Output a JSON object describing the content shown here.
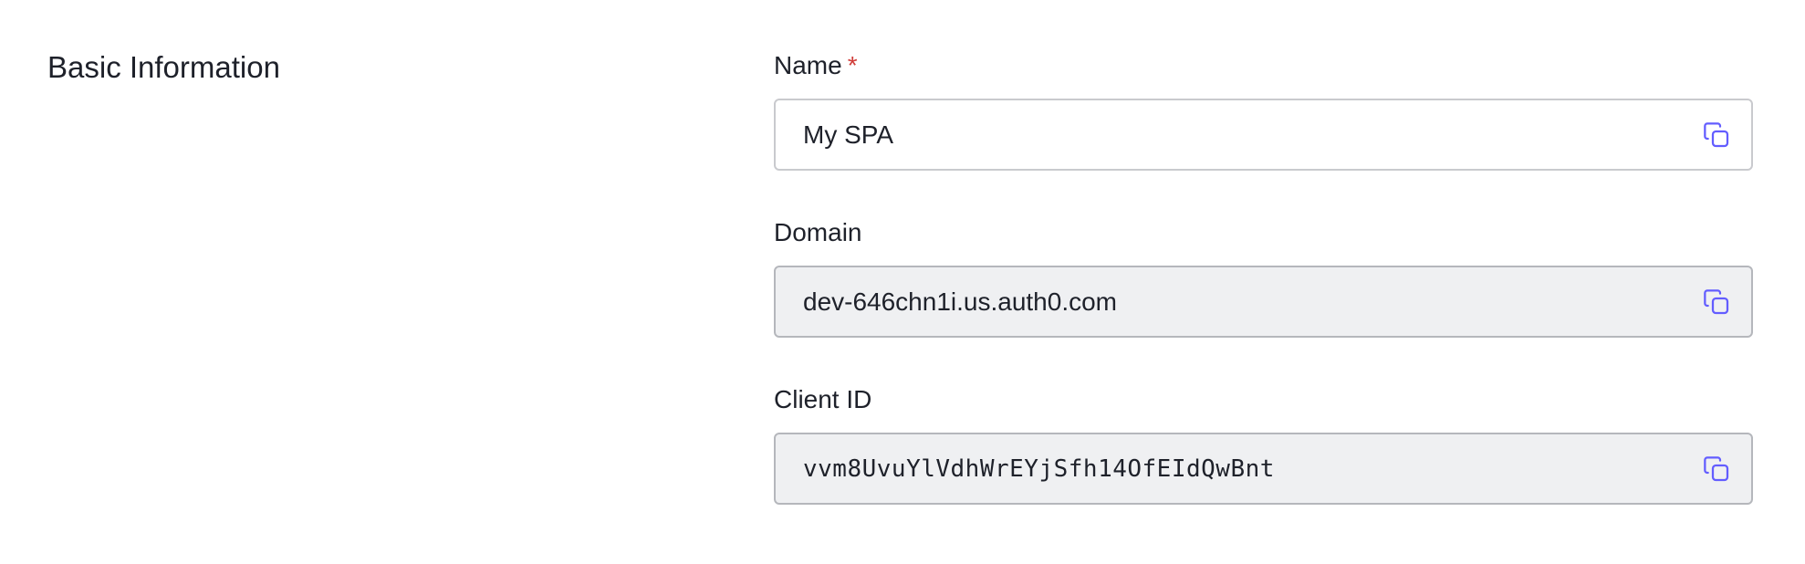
{
  "section": {
    "title": "Basic Information"
  },
  "fields": {
    "name": {
      "label": "Name",
      "required_mark": "*",
      "value": "My SPA",
      "copy_icon": "copy-icon"
    },
    "domain": {
      "label": "Domain",
      "value": "dev-646chn1i.us.auth0.com",
      "copy_icon": "copy-icon"
    },
    "client_id": {
      "label": "Client ID",
      "value": "vvm8UvuYlVdhWrEYjSfh14OfEIdQwBnt",
      "copy_icon": "copy-icon"
    }
  },
  "colors": {
    "accent": "#635dff",
    "required": "#d03c38",
    "readonly_bg": "#eff0f2"
  }
}
